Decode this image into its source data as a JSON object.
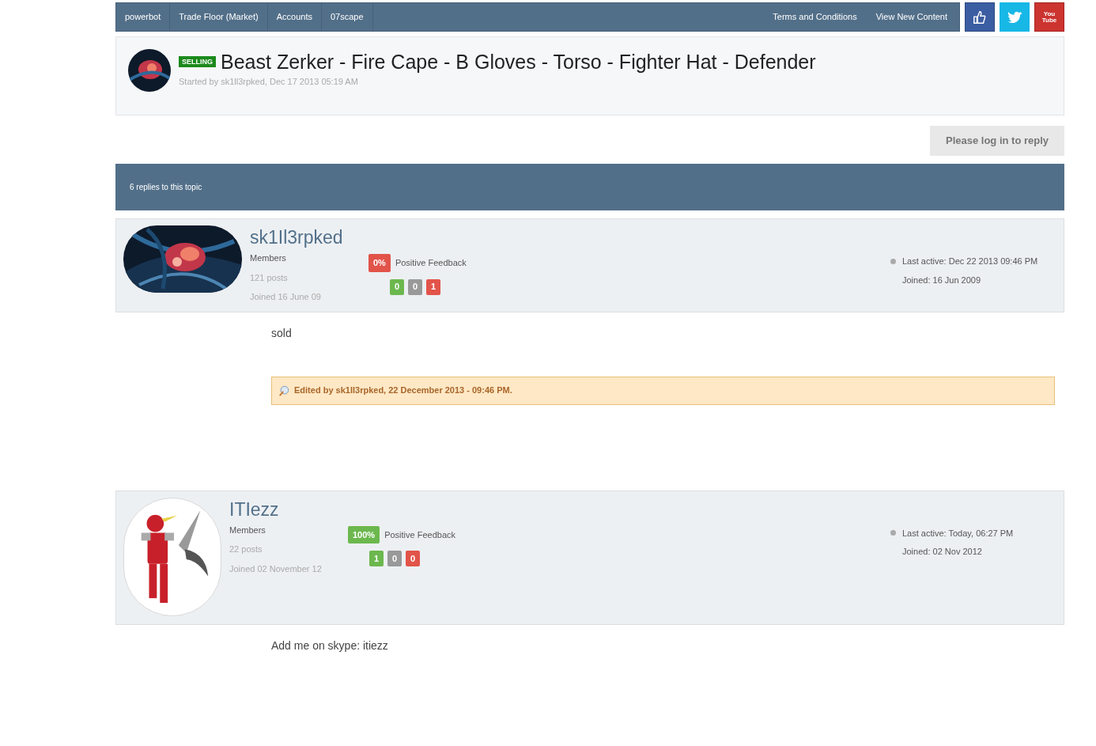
{
  "breadcrumbs": [
    "powerbot",
    "Trade Floor (Market)",
    "Accounts",
    "07scape"
  ],
  "nav_links": [
    "Terms and Conditions",
    "View New Content"
  ],
  "social": [
    {
      "kind": "like"
    },
    {
      "kind": "bird"
    },
    {
      "kind": "video",
      "label": [
        "You",
        "Tube"
      ]
    }
  ],
  "topic": {
    "badge": "SELLING",
    "title": "Beast Zerker - Fire Cape - B Gloves - Torso - Fighter Hat - Defender",
    "started": "Started by sk1ll3rpked, Dec 17 2013 05:19 AM"
  },
  "reply_button": "Please log in to reply",
  "replies_bar": "6 replies to this topic",
  "posts": [
    {
      "avatar": {
        "kind": "abstract"
      },
      "username": "sk1Il3rpked",
      "group": "Members",
      "posts": "121 posts",
      "joined": "Joined 16 June 09",
      "feedback_percent": "0%",
      "feedback": {
        "kind": "negative"
      },
      "feedback_label": "Positive Feedback",
      "counts": [
        {
          "kind": "positive",
          "value": "0"
        },
        {
          "kind": "neutral",
          "value": "0"
        },
        {
          "kind": "negative",
          "value": "1"
        }
      ],
      "last_active": "Last active: Dec 22 2013 09:46 PM",
      "member_since": "Joined: 16 Jun 2009",
      "body": "sold",
      "edited": "Edited by sk1Il3rpked, 22 December 2013 - 09:46 PM."
    },
    {
      "avatar": {
        "kind": "figure"
      },
      "username": "ITIezz",
      "group": "Members",
      "posts": "22 posts",
      "joined": "Joined 02 November 12",
      "feedback_percent": "100%",
      "feedback": {
        "kind": "positive"
      },
      "feedback_label": "Positive Feedback",
      "counts": [
        {
          "kind": "positive",
          "value": "1"
        },
        {
          "kind": "neutral",
          "value": "0"
        },
        {
          "kind": "negative",
          "value": "0"
        }
      ],
      "last_active": "Last active: Today, 06:27 PM",
      "member_since": "Joined: 02 Nov 2012",
      "body": "Add me on skype: itiezz"
    }
  ]
}
